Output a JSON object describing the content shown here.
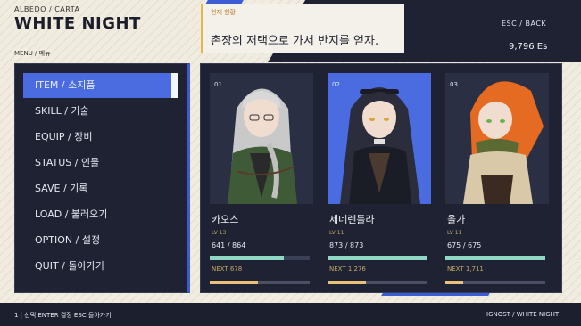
{
  "brand": {
    "subtitle": "ALBEDO / CARTA",
    "title": "WHITE NIGHT",
    "menu_label": "MENU / 메뉴"
  },
  "status": {
    "tag": "현재 현황",
    "message": "촌장의 저택으로 가서 반지를 얻자."
  },
  "top_right": {
    "esc_back": "ESC  /  BACK",
    "money": "9,796 Es"
  },
  "menu": {
    "items": [
      {
        "label": "ITEM  /  소지품",
        "active": true
      },
      {
        "label": "SKILL  /  기술",
        "active": false
      },
      {
        "label": "EQUIP  /  장비",
        "active": false
      },
      {
        "label": "STATUS  /  인물",
        "active": false
      },
      {
        "label": "SAVE  /  기록",
        "active": false
      },
      {
        "label": "LOAD  /  불러오기",
        "active": false
      },
      {
        "label": "OPTION  /  설정",
        "active": false
      },
      {
        "label": "QUIT  /  돌아가기",
        "active": false
      }
    ]
  },
  "characters": [
    {
      "num": "01",
      "name": "카오스",
      "lv": "LV 13",
      "hp": "641 / 864",
      "hp_ratio": 0.74,
      "next": "NEXT  678",
      "exp_ratio": 0.48,
      "hair": "#c9c9c9",
      "coat": "#3e5a37"
    },
    {
      "num": "02",
      "name": "세네렌톨라",
      "lv": "LV 11",
      "hp": "873 / 873",
      "hp_ratio": 1.0,
      "next": "NEXT  1,276",
      "exp_ratio": 0.38,
      "hair": "#2b2d3c",
      "coat": "#1b1d26"
    },
    {
      "num": "03",
      "name": "올가",
      "lv": "LV 11",
      "hp": "675 / 675",
      "hp_ratio": 1.0,
      "next": "NEXT  1,711",
      "exp_ratio": 0.18,
      "hair": "#e56a22",
      "coat": "#5b6a33"
    }
  ],
  "footer": {
    "left": "1  |  선택   ENTER 결정   ESC 돌아가기",
    "right": "IGNOST  /  WHITE NIGHT"
  },
  "colors": {
    "accent_blue": "#4a6ce0",
    "panel_dark": "#1e2232",
    "gold": "#e8b44c",
    "hp_teal": "#8fd8c4"
  }
}
